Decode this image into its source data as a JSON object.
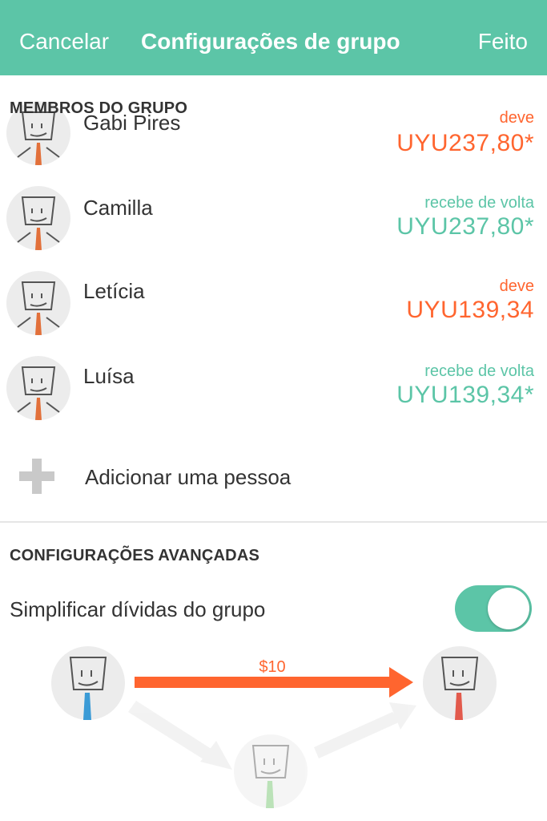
{
  "navbar": {
    "cancel_label": "Cancelar",
    "title": "Configurações de grupo",
    "done_label": "Feito"
  },
  "members_section": {
    "header": "MEMBROS DO GRUPO",
    "members": [
      {
        "name": "Gabi Pires",
        "status": "deve",
        "amount": "UYU237,80*",
        "tie_color": "#e2703a"
      },
      {
        "name": "Camilla",
        "status": "recebe de volta",
        "amount": "UYU237,80*",
        "tie_color": "#e2703a"
      },
      {
        "name": "Letícia",
        "status": "deve",
        "amount": "UYU139,34",
        "tie_color": "#e2703a"
      },
      {
        "name": "Luísa",
        "status": "recebe de volta",
        "amount": "UYU139,34*",
        "tie_color": "#e2703a"
      }
    ],
    "add_person_label": "Adicionar uma pessoa"
  },
  "advanced_section": {
    "header": "CONFIGURAÇÕES AVANÇADAS",
    "simplify_label": "Simplificar dívidas do grupo",
    "simplify_enabled": true
  },
  "diagram": {
    "amount_label": "$10",
    "tie_colors": [
      "#3b9bd6",
      "#e25a4c",
      "#8fd08a"
    ]
  },
  "colors": {
    "accent": "#5cc5a7",
    "owe": "#ff652f"
  }
}
